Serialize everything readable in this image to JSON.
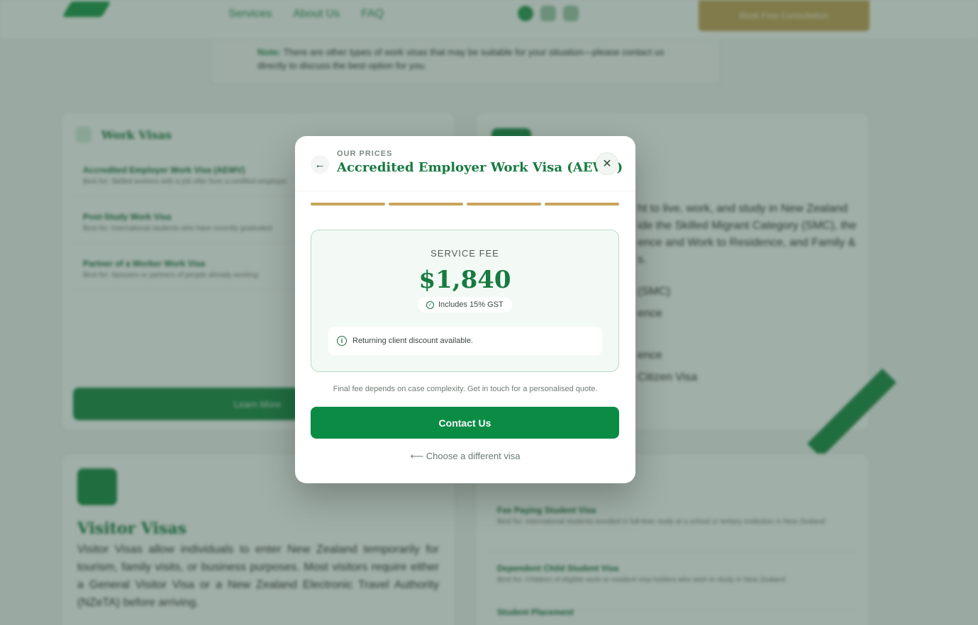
{
  "background": {
    "nav": [
      "Services",
      "About Us",
      "FAQ"
    ],
    "cta_label": "Book Free Consultation",
    "note_label": "Note:",
    "note_text": "There are other types of work visas that may be suitable for your situation—please contact us directly to discuss the best option for you.",
    "work_visas": {
      "title": "Work Visas",
      "items": [
        {
          "title": "Accredited Employer Work Visa (AEWV)",
          "sub": "Best for: Skilled workers with a job offer from a certified employer"
        },
        {
          "title": "Post-Study Work Visa",
          "sub": "Best for: International students who have recently graduated"
        },
        {
          "title": "Partner of a Worker Work Visa",
          "sub": "Best for: Spouses or partners of people already working"
        }
      ],
      "button": "Learn More"
    },
    "right_card": {
      "text": "ht to live, work, and study in New Zealand ide the Skilled Migrant Category (SMC), the ence and Work to Residence, and Family & s.",
      "list": [
        "(SMC)",
        "ence",
        "ence",
        "Citizen Visa"
      ]
    },
    "visitor": {
      "title": "Visitor Visas",
      "text": "Visitor Visas allow individuals to enter New Zealand temporarily for tourism, family visits, or business purposes. Most visitors require either a General Visitor Visa or a New Zealand Electronic Travel Authority (NZeTA) before arriving."
    },
    "student": {
      "items": [
        {
          "title": "Fee Paying Student Visa",
          "sub": "Best for: International students enrolled in full-time study at a school or tertiary institution in New Zealand"
        },
        {
          "title": "Dependent Child Student Visa",
          "sub": "Best for: Children of eligible work or resident visa holders who wish to study in New Zealand"
        },
        {
          "title": "Student Placement",
          "sub": ""
        }
      ]
    }
  },
  "modal": {
    "eyebrow": "OUR PRICES",
    "title": "Accredited Employer Work Visa (AEWV)",
    "steps_total": 4,
    "steps_completed": 4,
    "fee_label": "SERVICE FEE",
    "fee_amount": "$1,840",
    "gst_note": "Includes 15% GST",
    "discount_note": "Returning client discount available.",
    "fine_print": "Final fee depends on case complexity. Get in touch for a personalised quote.",
    "contact_label": "Contact Us",
    "choose_label": "⟵ Choose a different visa",
    "accent": "#177a3f",
    "gold": "#c8a45b"
  }
}
